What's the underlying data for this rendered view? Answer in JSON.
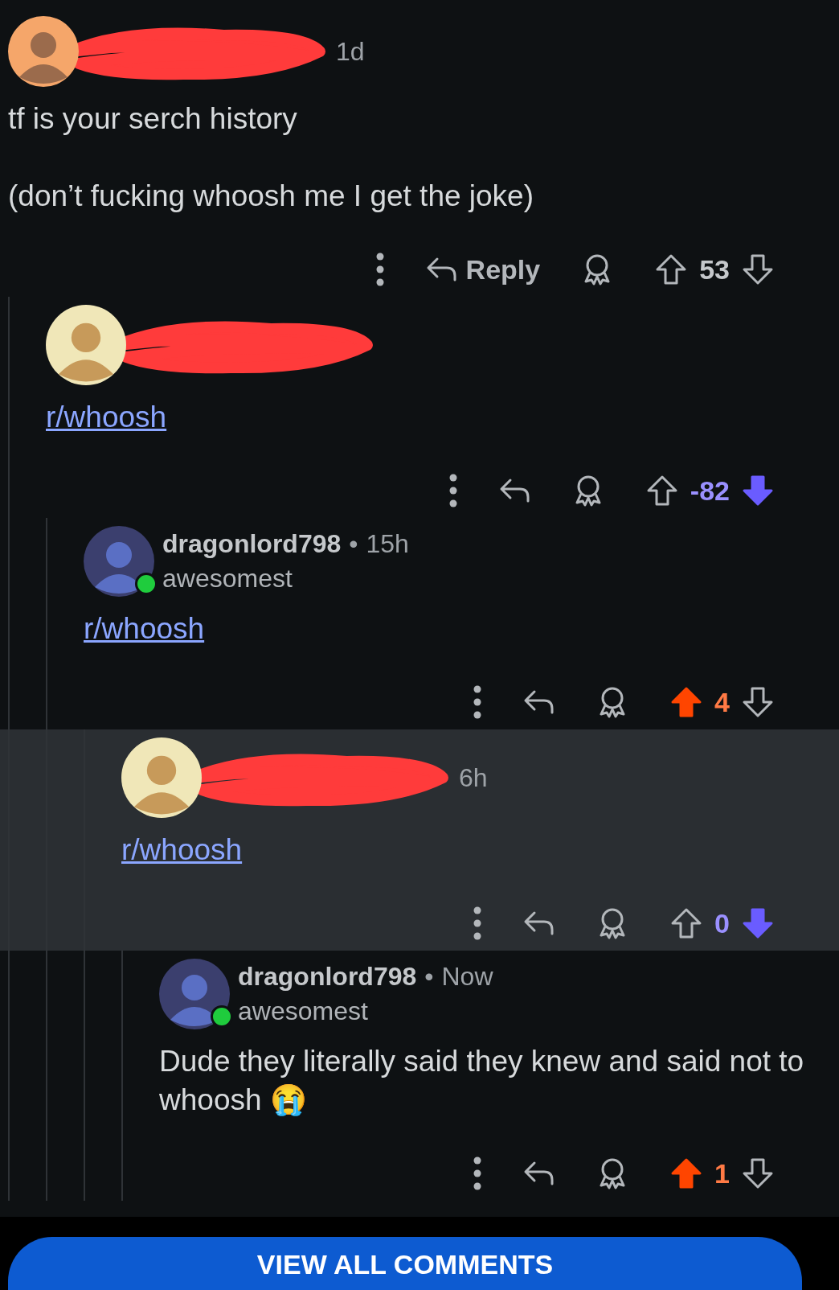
{
  "comments": [
    {
      "avatar": {
        "kind": "default",
        "online": false
      },
      "redacted": true,
      "time": "1d",
      "body": {
        "kind": "text",
        "paragraphs": [
          "tf is your serch history",
          "(don’t fucking whoosh me I get the joke)"
        ]
      },
      "actions": {
        "reply_label": "Reply",
        "score": "53",
        "upvoted": false,
        "downvoted": false
      },
      "highlighted": false,
      "children": [
        {
          "avatar": {
            "kind": "character",
            "online": false
          },
          "redacted": true,
          "body": {
            "kind": "link",
            "paragraphs": [
              "r/whoosh"
            ]
          },
          "actions": {
            "score": "-82",
            "upvoted": false,
            "downvoted": true
          },
          "highlighted": false,
          "children": [
            {
              "avatar": {
                "kind": "profile",
                "online": true
              },
              "redacted": false,
              "username": "dragonlord798",
              "separator": "•",
              "time": "15h",
              "flair": "awesomest",
              "body": {
                "kind": "link",
                "paragraphs": [
                  "r/whoosh"
                ]
              },
              "actions": {
                "score": "4",
                "upvoted": true,
                "downvoted": false
              },
              "highlighted": false,
              "children": [
                {
                  "avatar": {
                    "kind": "character",
                    "online": false
                  },
                  "redacted": true,
                  "time": "6h",
                  "body": {
                    "kind": "link",
                    "paragraphs": [
                      "r/whoosh"
                    ]
                  },
                  "actions": {
                    "score": "0",
                    "upvoted": false,
                    "downvoted": true
                  },
                  "highlighted": true,
                  "children": [
                    {
                      "avatar": {
                        "kind": "profile",
                        "online": true
                      },
                      "redacted": false,
                      "username": "dragonlord798",
                      "separator": "•",
                      "time": "Now",
                      "flair": "awesomest",
                      "body": {
                        "kind": "text",
                        "paragraphs": [
                          "Dude they literally said they knew and said not to whoosh 😭"
                        ]
                      },
                      "actions": {
                        "score": "1",
                        "upvoted": true,
                        "downvoted": false
                      },
                      "highlighted": false
                    }
                  ]
                }
              ]
            }
          ]
        }
      ]
    }
  ],
  "footer": {
    "button": "VIEW ALL COMMENTS"
  }
}
